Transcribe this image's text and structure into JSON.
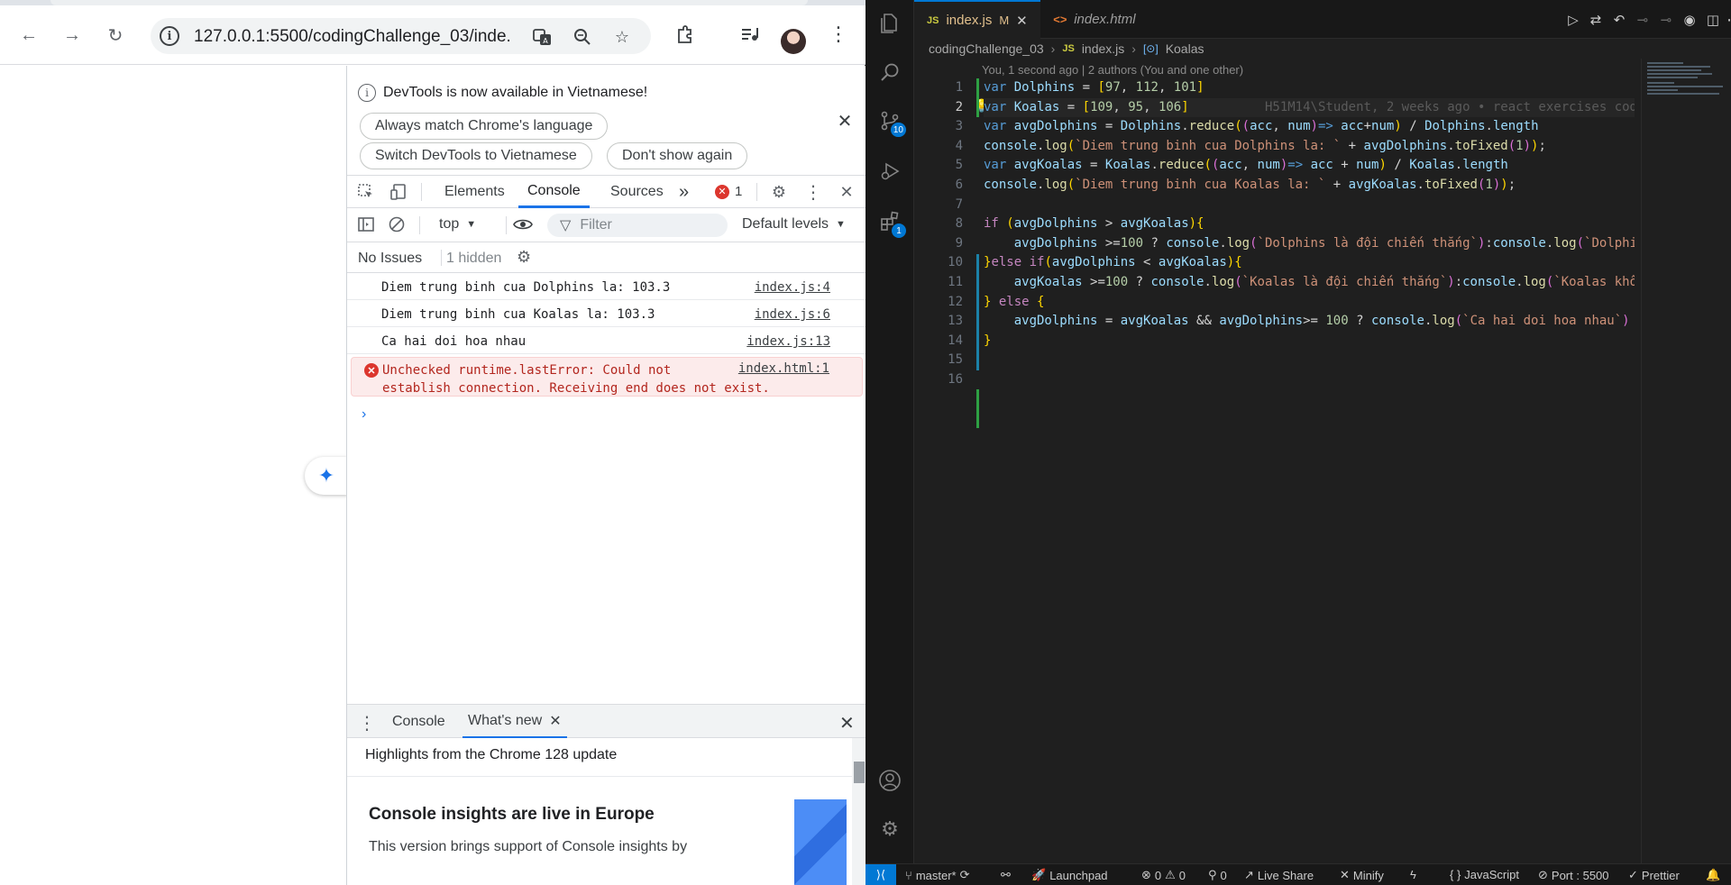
{
  "browser": {
    "url": "127.0.0.1:5500/codingChallenge_03/inde...",
    "nav": {
      "back": "←",
      "forward": "→",
      "reload": "↻"
    }
  },
  "devtools": {
    "infobar": {
      "message": "DevTools is now available in Vietnamese!",
      "match_language": "Always match Chrome's language",
      "switch_language": "Switch DevTools to Vietnamese",
      "dont_show": "Don't show again"
    },
    "tabs": [
      "Elements",
      "Console",
      "Sources"
    ],
    "more": "»",
    "error_count": "1",
    "context": "top",
    "filter_placeholder": "Filter",
    "levels": "Default levels",
    "issues": "No Issues",
    "hidden": "1 hidden",
    "logs": [
      {
        "text": "Diem trung binh cua Dolphins la: 103.3",
        "source": "index.js:4"
      },
      {
        "text": "Diem trung binh cua Koalas la: 103.3",
        "source": "index.js:6"
      },
      {
        "text": "Ca hai doi hoa nhau",
        "source": "index.js:13"
      }
    ],
    "error": {
      "line1": "Unchecked runtime.lastError: Could not",
      "line2": "establish connection. Receiving end does not exist.",
      "source": "index.html:1"
    },
    "prompt": "›",
    "drawer": {
      "tabs": [
        "Console",
        "What's new"
      ],
      "subtitle": "Highlights from the Chrome 128 update",
      "heading": "Console insights are live in Europe",
      "paragraph": "This version brings support of Console insights by"
    }
  },
  "vscode": {
    "tabs": [
      {
        "badge": "JS",
        "name": "index.js",
        "modified": "M"
      },
      {
        "badge": "<>",
        "name": "index.html"
      }
    ],
    "breadcrumbs": [
      "codingChallenge_03",
      "index.js",
      "Koalas"
    ],
    "blame_hint": "You, 1 second ago | 2 authors (You and one other)",
    "inline_blame": "H51M14\\Student, 2 weeks ago • react exercises cod",
    "line_numbers": [
      "1",
      "2",
      "3",
      "4",
      "5",
      "6",
      "7",
      "8",
      "9",
      "10",
      "11",
      "12",
      "13",
      "14",
      "15",
      "16"
    ],
    "current_line": "2",
    "activity_badges": {
      "scm": "10",
      "extensions": "1"
    },
    "status": {
      "branch": "master*",
      "launchpad": "Launchpad",
      "errors": "0",
      "warnings": "0",
      "ports": "0",
      "live_share": "Live Share",
      "minify": "Minify",
      "language": "JavaScript",
      "port": "Port : 5500",
      "prettier": "Prettier"
    }
  }
}
